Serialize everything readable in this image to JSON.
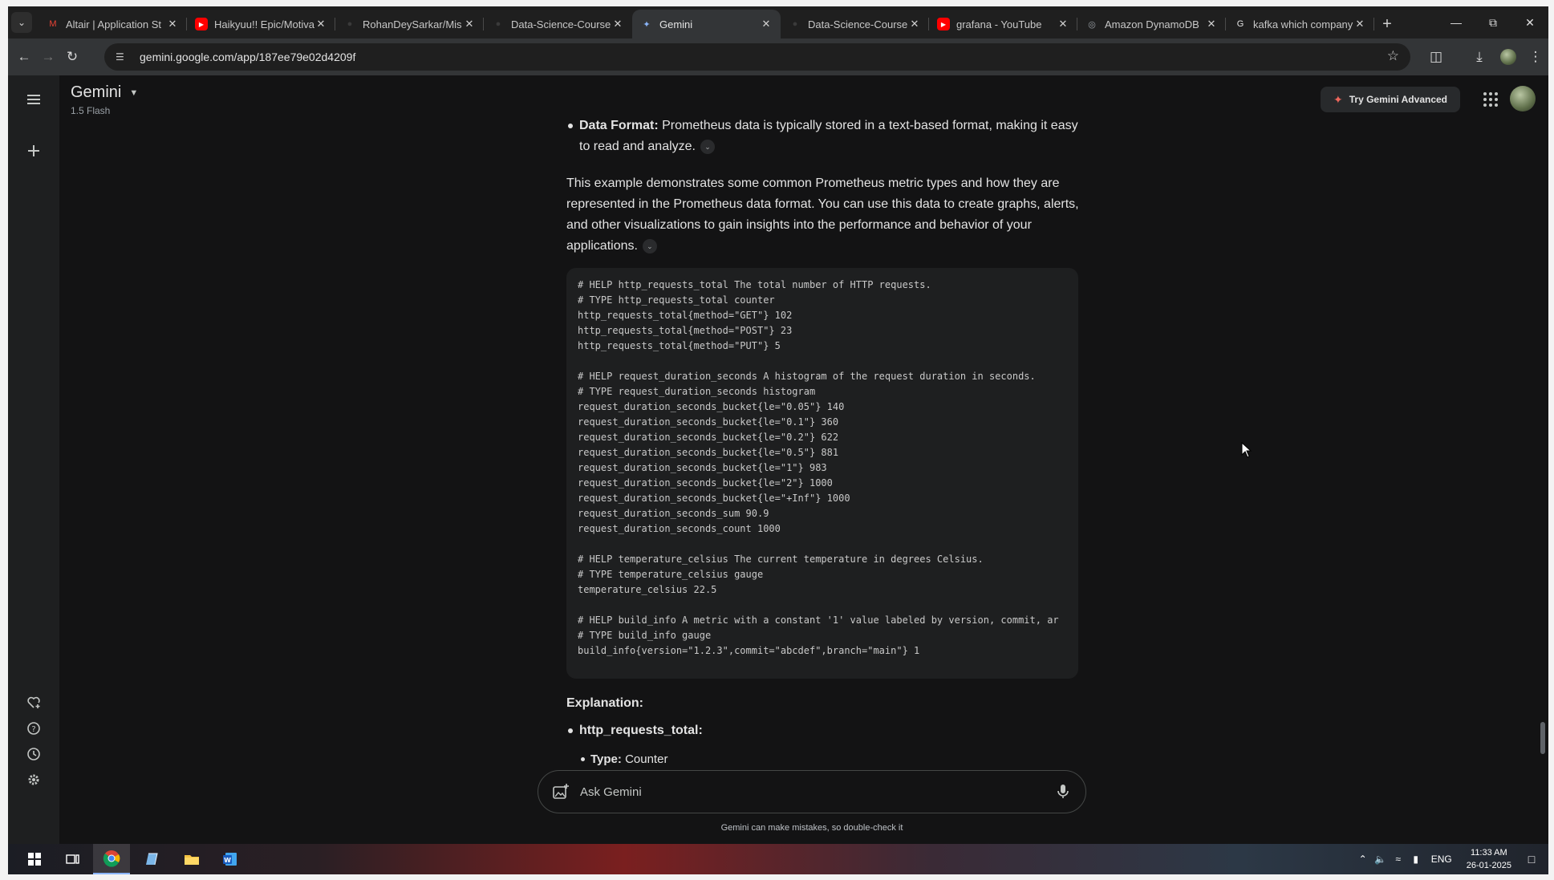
{
  "browser": {
    "tabs": [
      {
        "title": "Altair | Application St",
        "favicon": "gmail-icon",
        "color": "#ea4335",
        "active": false
      },
      {
        "title": "Haikyuu!! Epic/Motiva",
        "favicon": "youtube-icon",
        "color": "#ff0000",
        "active": false
      },
      {
        "title": "RohanDeySarkar/Mis",
        "favicon": "github-icon",
        "color": "#2b2b2b",
        "active": false
      },
      {
        "title": "Data-Science-Course",
        "favicon": "github-icon",
        "color": "#2b2b2b",
        "active": false
      },
      {
        "title": "Gemini",
        "favicon": "gemini-icon",
        "color": "#8ab4f8",
        "active": true
      },
      {
        "title": "Data-Science-Course",
        "favicon": "github-icon",
        "color": "#2b2b2b",
        "active": false
      },
      {
        "title": "grafana - YouTube",
        "favicon": "youtube-icon",
        "color": "#ff0000",
        "active": false
      },
      {
        "title": "Amazon DynamoDB",
        "favicon": "globe-icon",
        "color": "#9aa0a6",
        "active": false
      },
      {
        "title": "kafka which company",
        "favicon": "google-icon",
        "color": "#e3e3e3",
        "active": false
      }
    ],
    "url": "gemini.google.com/app/187ee79e02d4209f"
  },
  "app": {
    "name": "Gemini",
    "model": "1.5 Flash",
    "try_advanced": "Try Gemini Advanced",
    "accent": "#ee675c"
  },
  "conversation": {
    "data_format_bold": "Data Format:",
    "data_format_text": " Prometheus data is typically stored in a text-based format, making it easy to read and analyze.",
    "summary": "This example demonstrates some common Prometheus metric types and how they are represented in the Prometheus data format. You can use this data to create graphs, alerts, and other visualizations to gain insights into the performance and behavior of your applications.",
    "code_lines": [
      "# HELP http_requests_total The total number of HTTP requests.",
      "# TYPE http_requests_total counter",
      "http_requests_total{method=\"GET\"} 102",
      "http_requests_total{method=\"POST\"} 23",
      "http_requests_total{method=\"PUT\"} 5",
      "",
      "# HELP request_duration_seconds A histogram of the request duration in seconds.",
      "# TYPE request_duration_seconds histogram",
      "request_duration_seconds_bucket{le=\"0.05\"} 140",
      "request_duration_seconds_bucket{le=\"0.1\"} 360",
      "request_duration_seconds_bucket{le=\"0.2\"} 622",
      "request_duration_seconds_bucket{le=\"0.5\"} 881",
      "request_duration_seconds_bucket{le=\"1\"} 983",
      "request_duration_seconds_bucket{le=\"2\"} 1000",
      "request_duration_seconds_bucket{le=\"+Inf\"} 1000",
      "request_duration_seconds_sum 90.9",
      "request_duration_seconds_count 1000",
      "",
      "# HELP temperature_celsius The current temperature in degrees Celsius.",
      "# TYPE temperature_celsius gauge",
      "temperature_celsius 22.5",
      "",
      "# HELP build_info A metric with a constant '1' value labeled by version, commit, ar",
      "# TYPE build_info gauge",
      "build_info{version=\"1.2.3\",commit=\"abcdef\",branch=\"main\"} 1"
    ],
    "explanation_heading": "Explanation:",
    "metric_name": "http_requests_total:",
    "type_label": "Type:",
    "type_value": " Counter"
  },
  "prompt": {
    "placeholder": "Ask Gemini",
    "disclaimer": "Gemini can make mistakes, so double-check it"
  },
  "system": {
    "language": "ENG",
    "time": "11:33 AM",
    "date": "26-01-2025"
  }
}
